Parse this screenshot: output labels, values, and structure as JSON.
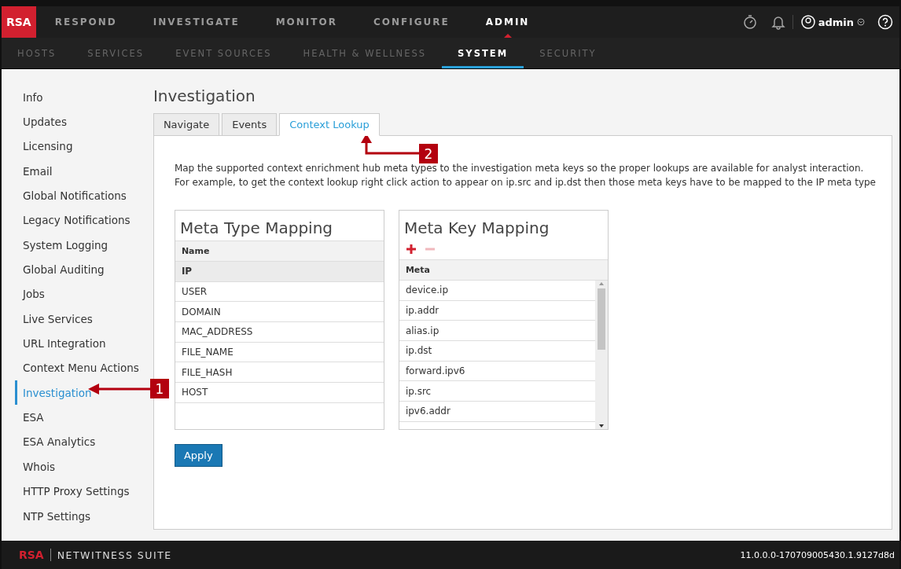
{
  "top_nav": {
    "logo": "RSA",
    "items": [
      {
        "label": "RESPOND",
        "selected": false
      },
      {
        "label": "INVESTIGATE",
        "selected": false
      },
      {
        "label": "MONITOR",
        "selected": false
      },
      {
        "label": "CONFIGURE",
        "selected": false
      },
      {
        "label": "ADMIN",
        "selected": true
      }
    ],
    "user": "admin"
  },
  "sub_nav": {
    "items": [
      {
        "label": "HOSTS",
        "selected": false
      },
      {
        "label": "SERVICES",
        "selected": false
      },
      {
        "label": "EVENT SOURCES",
        "selected": false
      },
      {
        "label": "HEALTH & WELLNESS",
        "selected": false
      },
      {
        "label": "SYSTEM",
        "selected": true
      },
      {
        "label": "SECURITY",
        "selected": false
      }
    ]
  },
  "sidebar": {
    "items": [
      {
        "label": "Info",
        "selected": false
      },
      {
        "label": "Updates",
        "selected": false
      },
      {
        "label": "Licensing",
        "selected": false
      },
      {
        "label": "Email",
        "selected": false
      },
      {
        "label": "Global Notifications",
        "selected": false
      },
      {
        "label": "Legacy Notifications",
        "selected": false
      },
      {
        "label": "System Logging",
        "selected": false
      },
      {
        "label": "Global Auditing",
        "selected": false
      },
      {
        "label": "Jobs",
        "selected": false
      },
      {
        "label": "Live Services",
        "selected": false
      },
      {
        "label": "URL Integration",
        "selected": false
      },
      {
        "label": "Context Menu Actions",
        "selected": false
      },
      {
        "label": "Investigation",
        "selected": true
      },
      {
        "label": "ESA",
        "selected": false
      },
      {
        "label": "ESA Analytics",
        "selected": false
      },
      {
        "label": "Whois",
        "selected": false
      },
      {
        "label": "HTTP Proxy Settings",
        "selected": false
      },
      {
        "label": "NTP Settings",
        "selected": false
      }
    ]
  },
  "content": {
    "title": "Investigation",
    "tabs": [
      {
        "label": "Navigate",
        "selected": false
      },
      {
        "label": "Events",
        "selected": false
      },
      {
        "label": "Context Lookup",
        "selected": true
      }
    ],
    "description": [
      "Map the supported context enrichment hub meta types to the investigation meta keys so the proper lookups are available for analyst interaction.",
      "For example, to get the context lookup right click action to appear on ip.src and ip.dst then those meta keys have to be mapped to the IP meta type"
    ],
    "meta_type_mapping": {
      "title": "Meta Type Mapping",
      "column": "Name",
      "rows": [
        {
          "name": "IP",
          "selected": true
        },
        {
          "name": "USER",
          "selected": false
        },
        {
          "name": "DOMAIN",
          "selected": false
        },
        {
          "name": "MAC_ADDRESS",
          "selected": false
        },
        {
          "name": "FILE_NAME",
          "selected": false
        },
        {
          "name": "FILE_HASH",
          "selected": false
        },
        {
          "name": "HOST",
          "selected": false
        }
      ]
    },
    "meta_key_mapping": {
      "title": "Meta Key Mapping",
      "remove_disabled": true,
      "column": "Meta",
      "rows": [
        "device.ip",
        "ip.addr",
        "alias.ip",
        "ip.dst",
        "forward.ipv6",
        "ip.src",
        "ipv6.addr"
      ]
    },
    "apply_button": "Apply"
  },
  "callouts": [
    "1",
    "2"
  ],
  "footer": {
    "logo": "RSA",
    "product": "NETWITNESS SUITE",
    "version": "11.0.0.0-170709005430.1.9127d8d"
  }
}
